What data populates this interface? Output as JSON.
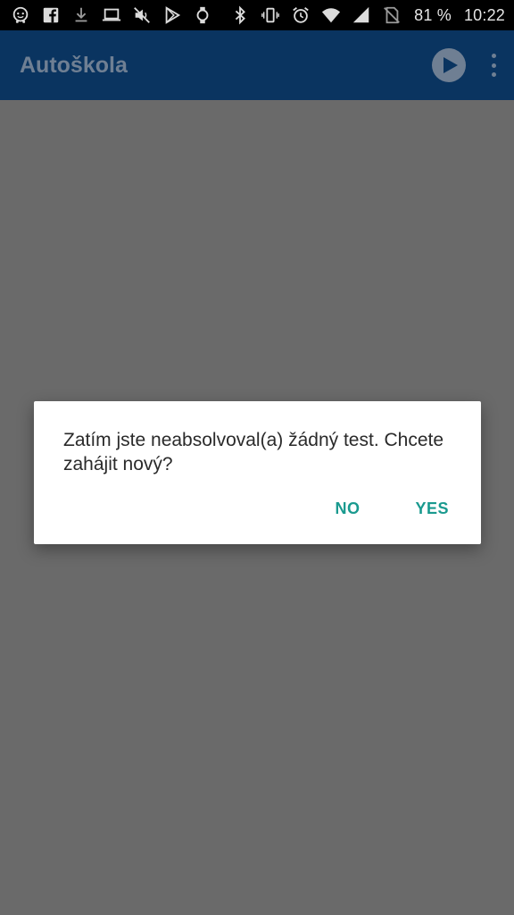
{
  "status_bar": {
    "battery_percent": "81 %",
    "time": "10:22",
    "left_icons": [
      "waze-icon",
      "facebook-icon",
      "download-icon",
      "laptop-icon",
      "mute-icon",
      "play-store-icon",
      "watch-icon"
    ],
    "right_icons": [
      "bluetooth-icon",
      "vibrate-icon",
      "alarm-icon",
      "wifi-icon",
      "signal-icon",
      "no-sim-icon"
    ]
  },
  "app_bar": {
    "title": "Autoškola",
    "actions": [
      "play-icon",
      "more-vert-icon"
    ]
  },
  "dialog": {
    "message": "Zatím jste neabsolvoval(a) žádný test. Chcete zahájit nový?",
    "negative_label": "NO",
    "positive_label": "YES"
  },
  "colors": {
    "status_bar": "#000000",
    "app_bar": "#0a3460",
    "scrim_background": "#6a6a6a",
    "dialog_background": "#ffffff",
    "button_accent": "#1a9a8f"
  }
}
